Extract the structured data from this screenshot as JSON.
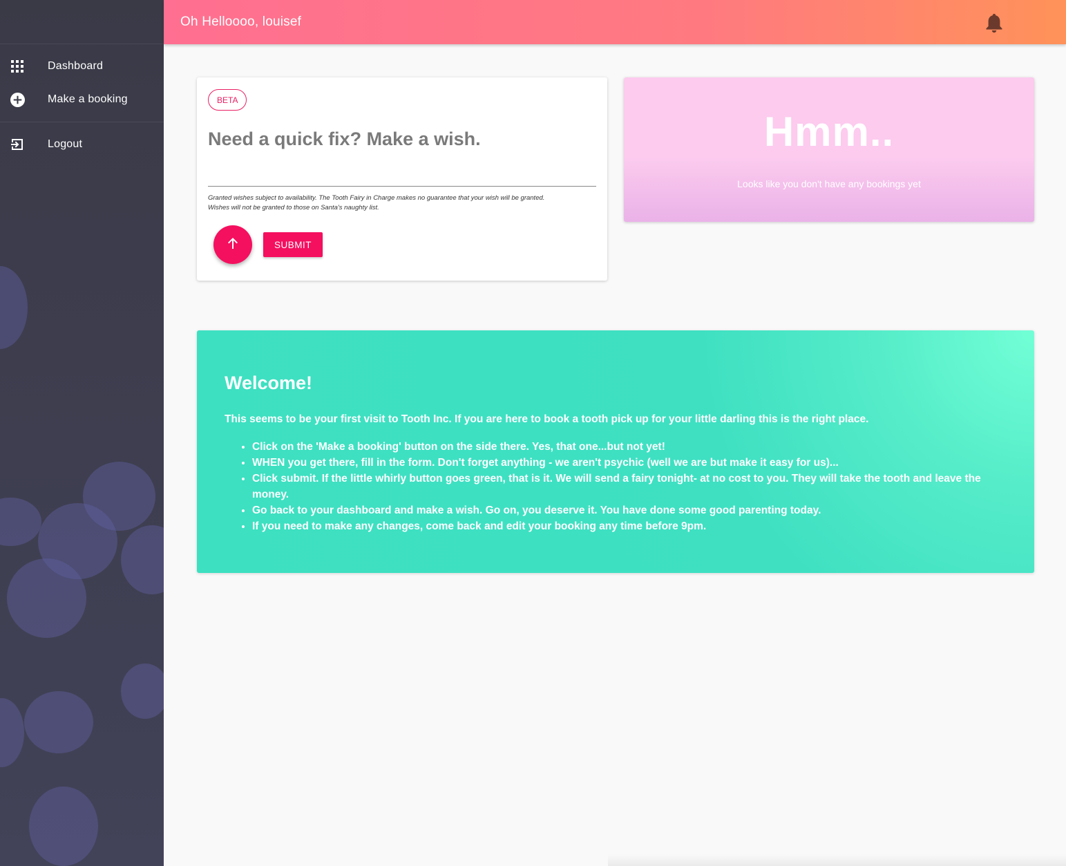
{
  "header": {
    "greeting": "Oh Helloooo, louisef",
    "notification_icon": "bell-icon",
    "gradient_start": "#ff6f91",
    "gradient_end": "#ff9259"
  },
  "sidebar": {
    "primary_items": [
      {
        "label": "Dashboard",
        "icon": "grid-icon"
      },
      {
        "label": "Make a booking",
        "icon": "add-circle-icon"
      }
    ],
    "secondary_items": [
      {
        "label": "Logout",
        "icon": "logout-icon"
      }
    ]
  },
  "wish_card": {
    "badge": "BETA",
    "input_placeholder": "Need a quick fix? Make a wish.",
    "input_value": "",
    "disclaimer_line1": "Granted wishes subject to availability. The Tooth Fairy in Charge makes no guarantee that your wish will be granted.",
    "disclaimer_line2": "Wishes will not be granted to those on Santa's naughty list.",
    "fab_icon": "arrow-up-icon",
    "submit_label": "SUBMIT",
    "accent_color": "#f50f5f"
  },
  "bookings_card": {
    "title": "Hmm..",
    "subtitle": "Looks like you don't have any bookings yet"
  },
  "welcome_card": {
    "title": "Welcome!",
    "intro": "This seems to be your first visit to Tooth Inc. If you are here to book a tooth pick up for your little darling this is the right place.",
    "steps": [
      "Click on the 'Make a booking' button on the side there. Yes, that one...but not yet!",
      "WHEN you get there, fill in the form. Don't forget anything - we aren't psychic (well we are but make it easy for us)...",
      "Click submit. If the little whirly button goes green, that is it. We will send a fairy tonight- at no cost to you. They will take the tooth and leave the money.",
      "Go back to your dashboard and make a wish. Go on, you deserve it. You have done some good parenting today.",
      "If you need to make any changes, come back and edit your booking any time before 9pm."
    ],
    "color": "#3de0c1"
  }
}
